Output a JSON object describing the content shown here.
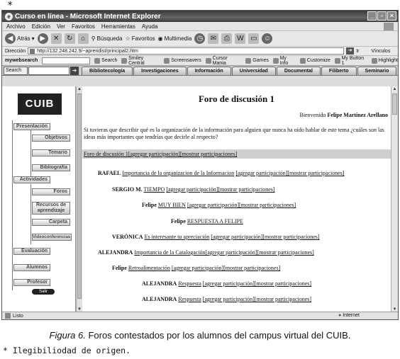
{
  "top_mark": "*",
  "window": {
    "title": "Curso en línea - Microsoft Internet Explorer",
    "buttons": [
      "_",
      "▫",
      "×"
    ]
  },
  "menu": [
    "Archivo",
    "Edición",
    "Ver",
    "Favoritos",
    "Herramientas",
    "Ayuda"
  ],
  "toolbar": {
    "back": "Atrás",
    "search": "Búsqueda",
    "favorites": "Favoritos",
    "multimedia": "Multimedia"
  },
  "address": {
    "label": "Dirección",
    "url": "http://132.248.242.9/~aprendist/principal2.htm",
    "go": "Ir",
    "links": "Vínculos"
  },
  "links_bar": {
    "brand": "mywebsearch",
    "items": [
      "Search",
      "Smiley Central",
      "Screensavers",
      "Cursor Mania",
      "Games",
      "My Info",
      "Customize",
      "My Button 1",
      "Highlight"
    ]
  },
  "site_tabs": {
    "search_label": "Search",
    "tabs": [
      "Bibliotecología",
      "Investigaciones",
      "Información",
      "Universidad",
      "Documental",
      "Filiberto",
      "Seminario"
    ]
  },
  "sidebar": {
    "logo": "CUIB",
    "items": [
      {
        "label": "Presentación"
      },
      {
        "label": "Objetivos"
      },
      {
        "label": "Temario"
      },
      {
        "label": "Bibliografía"
      },
      {
        "label": "Actividades"
      },
      {
        "label": "Foros"
      },
      {
        "label": "Recursos de aprendizaje"
      },
      {
        "label": "Carpeta"
      },
      {
        "label": "Videoconferencias"
      },
      {
        "label": "Evaluación"
      },
      {
        "label": "Alumnos"
      },
      {
        "label": "Profesor"
      }
    ],
    "exit": "Salir"
  },
  "main": {
    "title": "Foro de discusión 1",
    "welcome_prefix": "Bienvenido",
    "welcome_name": "Felipe Martínez Arellano",
    "question": "Si tuvieras que describir qué es la organización de la información para alguien que nunca ha oído hablar de este tema ¿cuáles son las ideas más importantes que tendrías que decirle al respecto?",
    "forum_bar": {
      "title": "Foro de discusión 1",
      "add": "[agregar participación]",
      "show": "[mostrar participaciones]"
    },
    "posts": [
      {
        "author": "RAFAEL",
        "subject": "Importancia de la organizacion de la Informacion",
        "add": "[agregar participación]",
        "show": "[mostrar participaciones]"
      },
      {
        "author": "SERGIO M.",
        "subject": "TIEMPO",
        "add": "[agregar participación]",
        "show": "[mostrar participaciones]"
      },
      {
        "author": "Felipe",
        "subject": "MUY BIEN",
        "add": "[agregar participación]",
        "show": "[mostrar participaciones]"
      },
      {
        "author": "Felipe",
        "subject": "RESPUESTA A FELIPE",
        "add": "",
        "show": ""
      },
      {
        "author": "VERÓNICA",
        "subject": "Es interesante tu apreciación",
        "add": "[agregar participación]",
        "show": "[mostrar participaciones]"
      },
      {
        "author": "ALEJANDRA",
        "subject": "Importancia de la Catalogación",
        "add": "[agregar participación]",
        "show": "[mostrar participaciones]"
      },
      {
        "author": "Felipe",
        "subject": "Retroalimentación",
        "add": "[agregar participación]",
        "show": "[mostrar participaciones]"
      },
      {
        "author": "ALEJANDRA",
        "subject": "Respuesta",
        "add": "[agregar participación]",
        "show": "[mostrar participaciones]"
      },
      {
        "author": "ALEJANDRA",
        "subject": "Respuesta",
        "add": "[agregar participación]",
        "show": "[mostrar participaciones]"
      }
    ]
  },
  "status": {
    "text": "Listo",
    "zone": "Internet"
  },
  "caption": {
    "figure": "Figura 6.",
    "text": "Foros contestados por los alumnos del campus virtual del CUIB."
  },
  "footnote": "* Ilegibiliodad de origen."
}
